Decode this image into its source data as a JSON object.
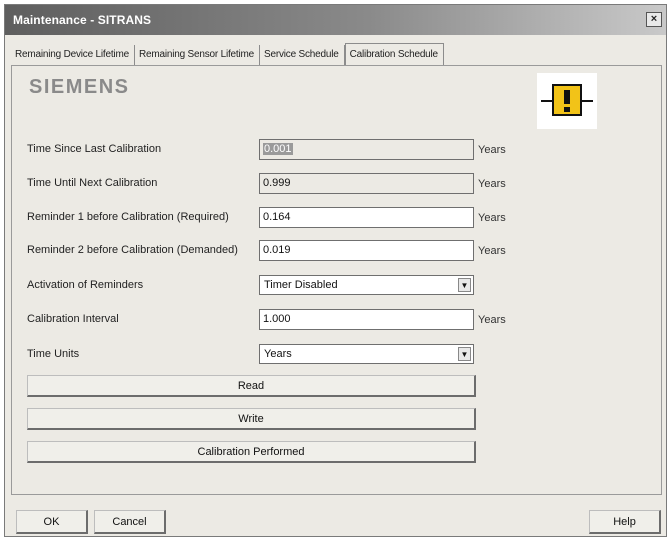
{
  "window": {
    "title": "Maintenance - SITRANS",
    "close_glyph": "×"
  },
  "tabs": [
    {
      "label": "Remaining Device Lifetime"
    },
    {
      "label": "Remaining Sensor Lifetime"
    },
    {
      "label": "Service Schedule"
    },
    {
      "label": "Calibration Schedule",
      "active": true
    }
  ],
  "brand": {
    "logo": "SIEMENS",
    "status_icon": "maintenance-required-icon"
  },
  "form": {
    "time_since": {
      "label": "Time Since Last Calibration",
      "value": "0.001",
      "unit": "Years"
    },
    "time_until": {
      "label": "Time Until Next Calibration",
      "value": "0.999",
      "unit": "Years"
    },
    "reminder1": {
      "label": "Reminder 1 before Calibration (Required)",
      "value": "0.164",
      "unit": "Years"
    },
    "reminder2": {
      "label": "Reminder 2 before Calibration (Demanded)",
      "value": "0.019",
      "unit": "Years"
    },
    "activation": {
      "label": "Activation of Reminders",
      "value": "Timer Disabled"
    },
    "interval": {
      "label": "Calibration Interval",
      "value": "1.000",
      "unit": "Years"
    },
    "time_units": {
      "label": "Time Units",
      "value": "Years"
    }
  },
  "actions": {
    "read": "Read",
    "write": "Write",
    "performed": "Calibration Performed"
  },
  "footer": {
    "ok": "OK",
    "cancel": "Cancel",
    "help": "Help"
  },
  "colors": {
    "status_yellow": "#f2c318",
    "status_black": "#111111"
  }
}
